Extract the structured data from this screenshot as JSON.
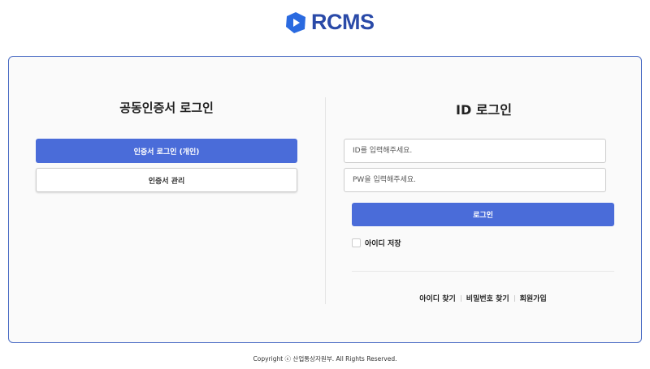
{
  "logo": {
    "text": "RCMS",
    "color": "#2a4aa8"
  },
  "cert": {
    "title": "공동인증서 로그인",
    "login_button": "인증서 로그인 (개인)",
    "manage_button": "인증서 관리"
  },
  "id_login": {
    "title": "ID 로그인",
    "id_placeholder": "ID를 입력해주세요.",
    "pw_placeholder": "PW을 입력해주세요.",
    "login_button": "로그인",
    "remember_label": "아이디 저장"
  },
  "links": {
    "find_id": "아이디 찾기",
    "find_pw": "비밀번호 찾기",
    "signup": "회원가입"
  },
  "footer": {
    "copyright": "Copyright ⓒ 산업통상자원부. All Rights Reserved."
  },
  "colors": {
    "accent": "#4a6cd9"
  }
}
